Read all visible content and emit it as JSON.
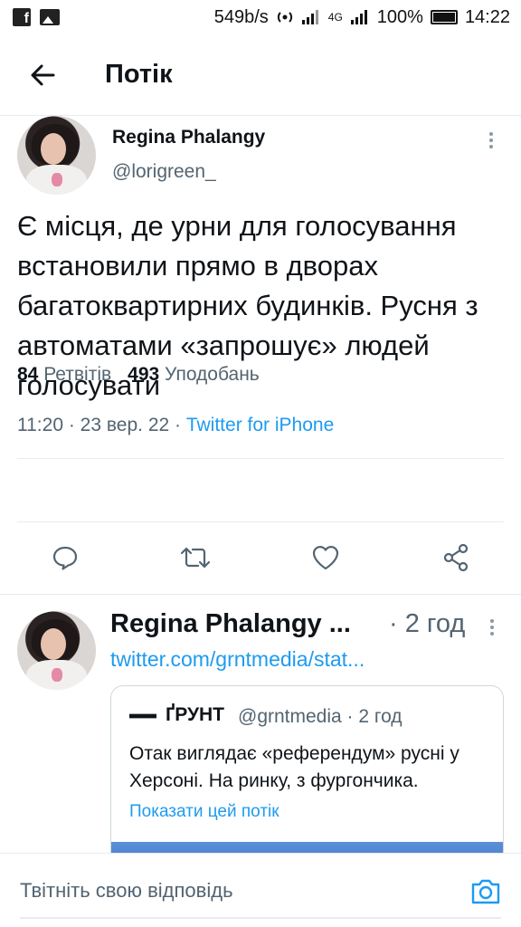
{
  "status_bar": {
    "speed": "549b/s",
    "network": "4G",
    "battery": "100%",
    "time": "14:22"
  },
  "header": {
    "title": "Потік"
  },
  "main_tweet": {
    "name": "Regina Phalangy",
    "handle": "@lorigreen_",
    "text": "Є місця, де урни для голосування встановили прямо в дворах багатоквартирних будинків. Русня з автоматами «запрошує» людей голосувати",
    "time": "11:20",
    "date": "23 вер. 22",
    "source": "Twitter for iPhone",
    "retweets_count": "84",
    "retweets_label": "Ретвітів",
    "likes_count": "493",
    "likes_label": "Уподобань"
  },
  "reply_tweet": {
    "name": "Regina Phalangy ...",
    "time": "· 2 год",
    "link": "twitter.com/grntmedia/stat...",
    "quote": {
      "name": "ҐРУНТ",
      "handle": "@grntmedia · 2 год",
      "text": "Отак виглядає «референдум» русні у Херсоні. На ринку, з фургончика.",
      "show_thread": "Показати цей потік"
    }
  },
  "composer": {
    "placeholder": "Твітніть свою відповідь"
  },
  "colors": {
    "accent": "#1d9bf0",
    "secondary_text": "#536471",
    "divider": "#e6ecf0"
  },
  "icons": [
    "back-arrow-icon",
    "more-vertical-icon",
    "reply-icon",
    "retweet-icon",
    "like-icon",
    "share-icon",
    "camera-icon"
  ]
}
